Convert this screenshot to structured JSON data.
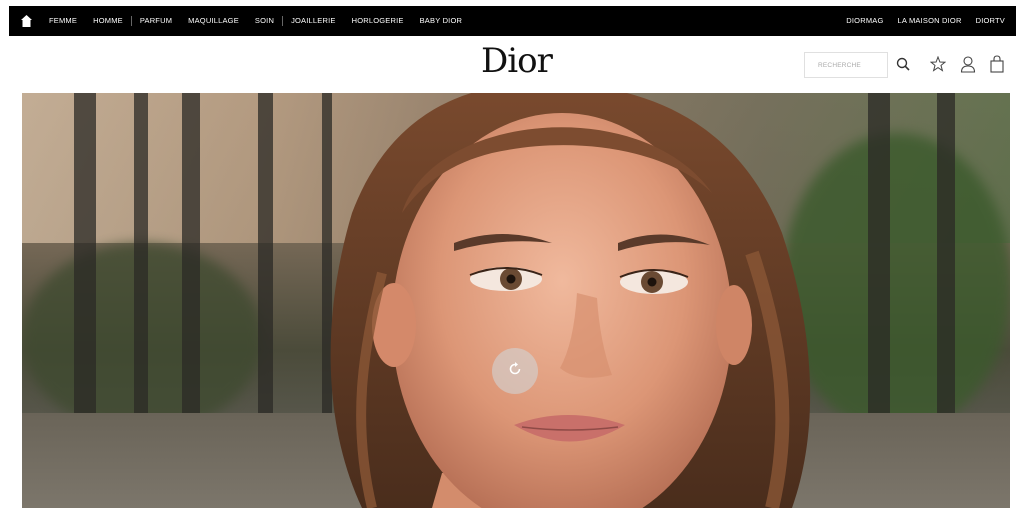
{
  "nav": {
    "home_icon": "home-icon",
    "left": [
      "FEMME",
      "HOMME",
      "PARFUM",
      "MAQUILLAGE",
      "SOIN",
      "JOAILLERIE",
      "HORLOGERIE",
      "BABY DIOR"
    ],
    "right": [
      "DIORMAG",
      "LA MAISON DIOR",
      "DIORTV"
    ]
  },
  "header": {
    "logo": "Dior",
    "search_placeholder": "RECHERCHE",
    "icons": [
      "search-icon",
      "star-icon",
      "user-icon",
      "bag-icon"
    ]
  },
  "hero": {
    "replay_icon": "replay-icon"
  },
  "colors": {
    "nav_bg": "#000000",
    "nav_text": "#ffffff"
  }
}
